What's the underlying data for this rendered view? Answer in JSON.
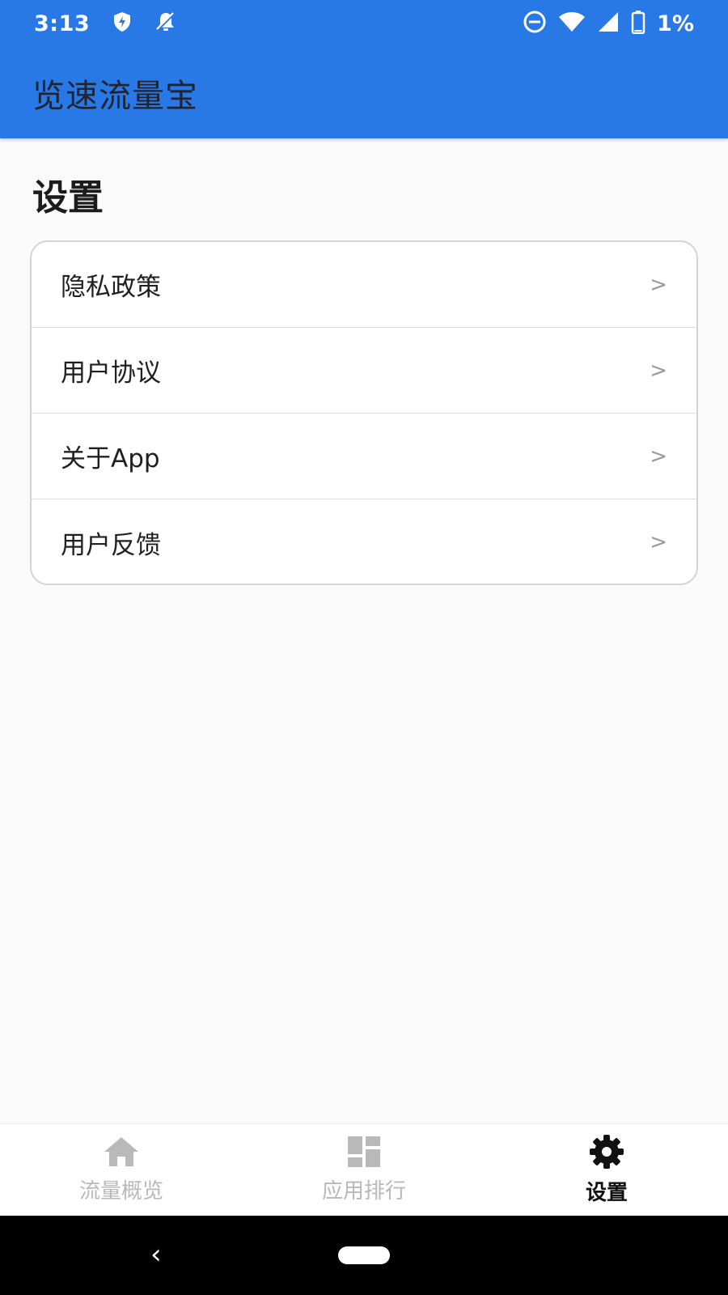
{
  "status_bar": {
    "time": "3:13",
    "battery_text": "1%",
    "icons": [
      "shield-icon",
      "notifications-off-icon",
      "do-not-disturb-icon",
      "wifi-icon",
      "signal-icon",
      "battery-icon"
    ]
  },
  "app_bar": {
    "title": "览速流量宝"
  },
  "page": {
    "title": "设置"
  },
  "settings": {
    "items": [
      {
        "label": "隐私政策",
        "chevron": ">"
      },
      {
        "label": "用户协议",
        "chevron": ">"
      },
      {
        "label": "关于App",
        "chevron": ">"
      },
      {
        "label": "用户反馈",
        "chevron": ">"
      }
    ]
  },
  "bottom_nav": {
    "items": [
      {
        "label": "流量概览",
        "icon": "home-icon",
        "active": false
      },
      {
        "label": "应用排行",
        "icon": "dashboard-icon",
        "active": false
      },
      {
        "label": "设置",
        "icon": "gear-icon",
        "active": true
      }
    ]
  },
  "colors": {
    "primary": "#2878e6",
    "nav_inactive": "#b9b9b9",
    "nav_active": "#111111"
  }
}
